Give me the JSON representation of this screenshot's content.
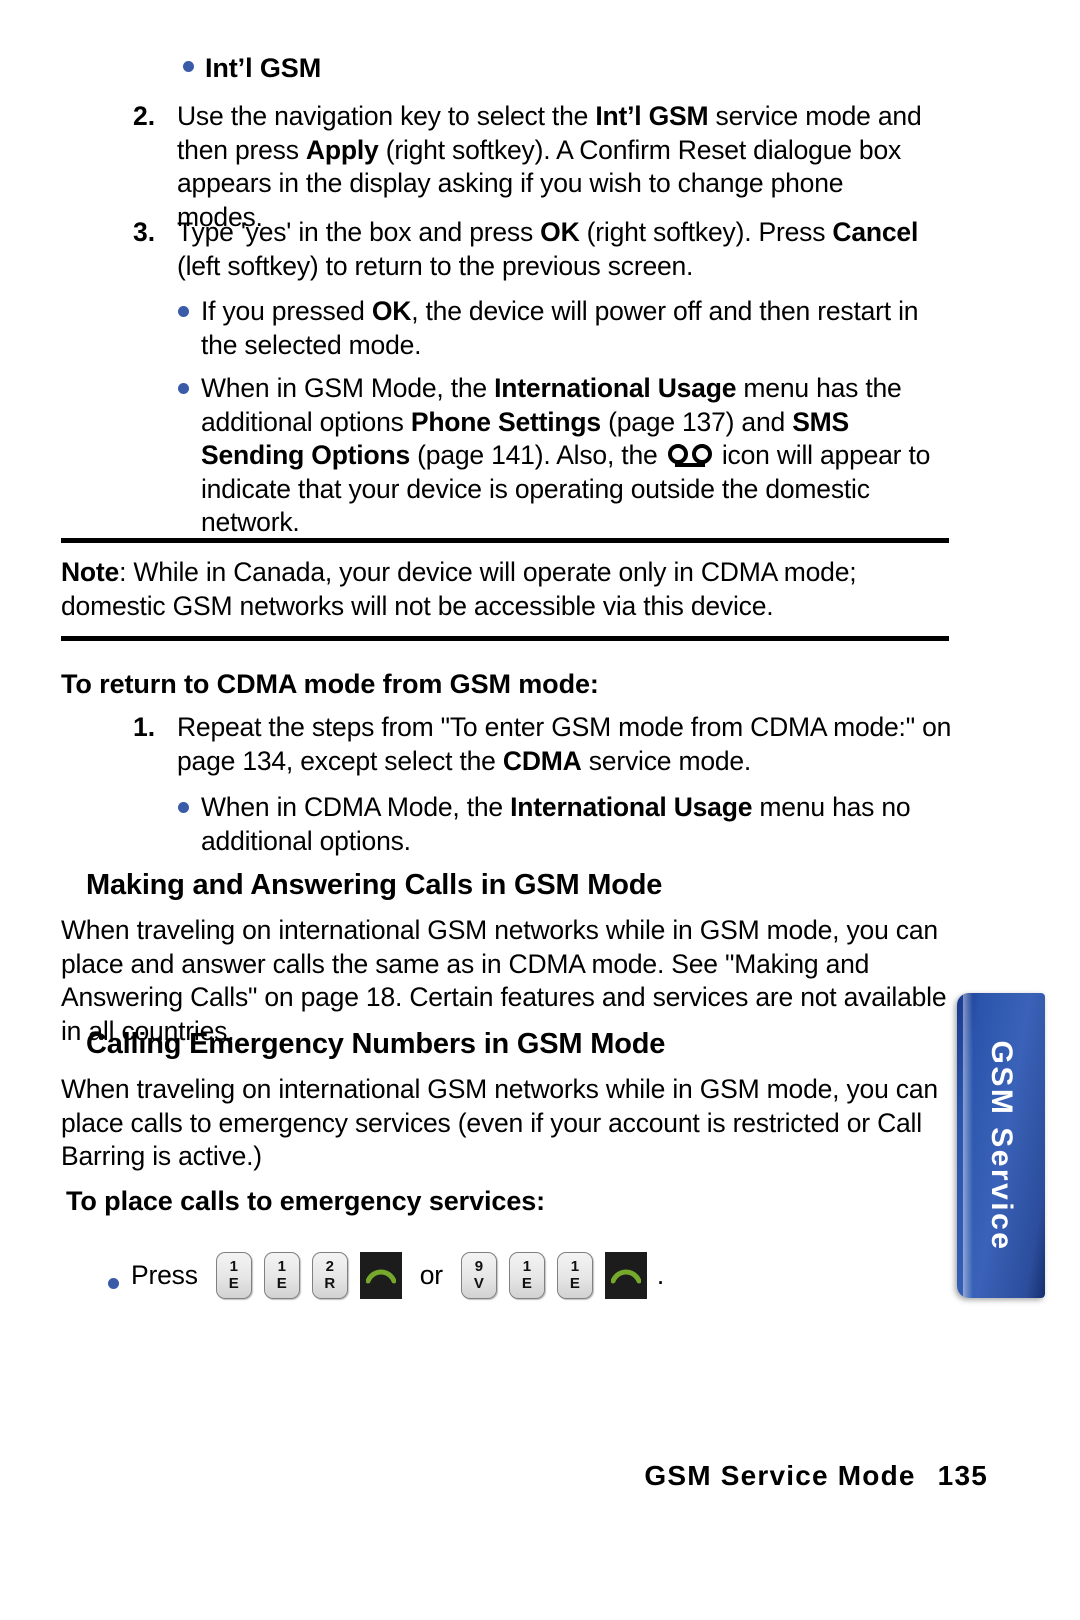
{
  "page": {
    "number": "135",
    "footer_title": "GSM Service Mode",
    "side_tab_label": "GSM Service"
  },
  "intro_bullet": {
    "label": "Int’l GSM"
  },
  "steps_top": [
    {
      "number": "2.",
      "text_1": "Use the navigation key to select the ",
      "bold_1": "Int’l GSM",
      "text_2": " service mode and then press ",
      "bold_2": "Apply",
      "text_3": " (right softkey). A Confirm Reset dialogue box appears in the display asking if you wish to change phone modes."
    },
    {
      "number": "3.",
      "text_1": "Type 'yes' in the box and press ",
      "bold_1": "OK",
      "text_2": " (right softkey). Press ",
      "bold_2": "Cancel",
      "text_3": " (left softkey) to return to the previous screen."
    }
  ],
  "step3_bullets": [
    {
      "text_1": "If you pressed ",
      "bold_1": "OK",
      "text_2": ", the device will power off and then restart in the selected mode."
    },
    {
      "text_1": "When in GSM Mode, the ",
      "bold_1": "International Usage",
      "text_2": " menu has the additional options ",
      "bold_2": "Phone Settings",
      "text_3": " (page 137) and ",
      "bold_3": "SMS Sending Options",
      "text_4": " (page 141). Also, the ",
      "icon_name": "roaming-icon",
      "text_5": " icon will appear to indicate that your device is operating outside the domestic network."
    }
  ],
  "note": {
    "label": "Note",
    "text": ": While in Canada, your device will operate only in CDMA mode; domestic GSM networks will not be accessible via this device."
  },
  "return_section": {
    "heading": "To return to CDMA mode from GSM mode:",
    "step": {
      "number": "1.",
      "text_1": "Repeat the steps from \"To enter GSM mode from CDMA mode:\" on page 134, except select the ",
      "bold_1": "CDMA",
      "text_2": " service mode."
    },
    "bullet": {
      "text_1": "When in CDMA Mode, the ",
      "bold_1": "International Usage",
      "text_2": " menu has no additional options."
    }
  },
  "making_section": {
    "heading": "Making and Answering Calls in GSM Mode",
    "paragraph": "When traveling on international GSM networks while in GSM mode, you can place and answer calls the same as in CDMA mode. See \"Making and Answering Calls\" on page 18. Certain features and services are not available in all countries."
  },
  "emergency_section": {
    "heading": "Calling Emergency Numbers in GSM Mode",
    "paragraph": "When traveling on international GSM networks while in GSM mode, you can place calls to emergency services (even if your account is restricted or Call Barring is active.)",
    "subheading": "To place calls to emergency services:",
    "press_label": "Press",
    "or_label": "or",
    "period": ".",
    "sequence_1": [
      {
        "num": "1",
        "letter": "E"
      },
      {
        "num": "1",
        "letter": "E"
      },
      {
        "num": "2",
        "letter": "R"
      }
    ],
    "send_key_1": "send-key",
    "sequence_2": [
      {
        "num": "9",
        "letter": "V"
      },
      {
        "num": "1",
        "letter": "E"
      },
      {
        "num": "1",
        "letter": "E"
      }
    ],
    "send_key_2": "send-key"
  },
  "colors": {
    "bullet": "#3a5ba8",
    "tab_blue": "#2b55ad",
    "send_green": "#76a82b",
    "rule": "#000000"
  }
}
